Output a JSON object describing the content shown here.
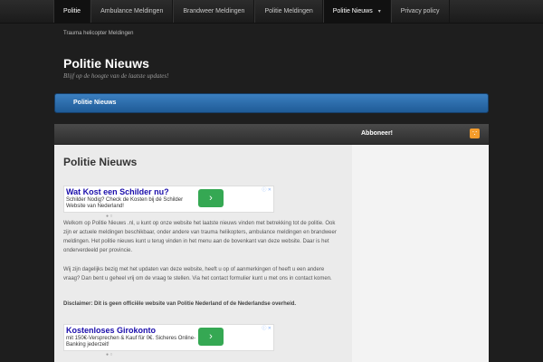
{
  "nav": {
    "items": [
      {
        "label": "Politie"
      },
      {
        "label": "Ambulance Meldingen"
      },
      {
        "label": "Brandweer Meldingen"
      },
      {
        "label": "Politie Meldingen"
      },
      {
        "label": "Politie Nieuws"
      },
      {
        "label": "Privacy policy"
      }
    ],
    "dropdown_icon": "chevron-down-icon",
    "subnav_item": "Trauma helicopter Meldingen"
  },
  "site": {
    "title": "Politie Nieuws",
    "description": "Blijf op de hoogte van de laatste updates!"
  },
  "breadcrumb_bar": {
    "label": "Politie Nieuws"
  },
  "sidebar": {
    "title": "Abboneer!",
    "rss_icon": "rss-icon"
  },
  "main": {
    "page_title": "Politie Nieuws",
    "ad1": {
      "title": "Wat Kost een Schilder nu?",
      "text": "Schilder Nodig? Check de Kosten bij dé Schilder Website van Nederland!",
      "arrow": "›"
    },
    "paragraph1": "Welkom op Politie Nieuws .nl, u kunt op onze website het laatste nieuws vinden met betrekking tot de politie. Ook zijn er actuele meldingen beschikbaar, onder andere van trauma helikopters, ambulance meldingen en brandweer meldingen. Het politie nieuws kunt u terug vinden in het menu aan de bovenkant van deze website. Daar is het onderverdeeld per provincie.",
    "paragraph2": "Wij zijn dagelijks bezig met het updaten van deze website, heeft u op of aanmerkingen of heeft u een andere vraag? Dan bent u geheel vrij om de vraag te stellen. Via het contact formulier kunt u met ons in contact komen.",
    "disclaimer": "Disclaimer: Dit is geen officiële website van Politie Nederland of de Nederlandse overheid.",
    "ad2": {
      "title": "Kostenloses Girokonto",
      "text": "mit 150€-Versprechen & Kauf für 0€. Sicheres Online-Banking jederzeit!",
      "arrow": "›"
    }
  },
  "colors": {
    "accent_blue": "#2a6aa9",
    "ad_button_green": "#35a853",
    "rss_orange": "#f39c2c"
  }
}
